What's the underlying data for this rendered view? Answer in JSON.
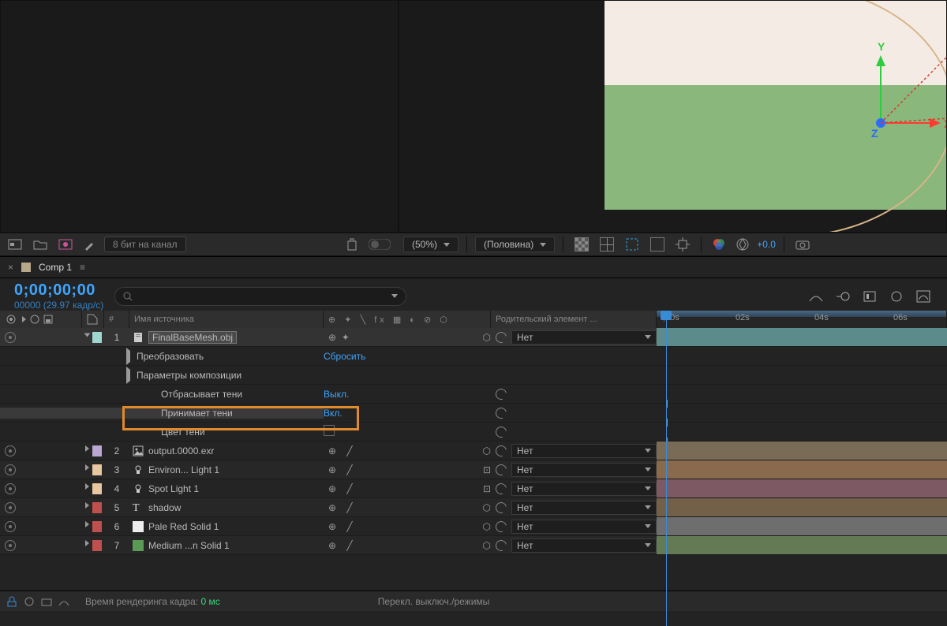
{
  "viewport": {
    "axis": {
      "x": "X",
      "y": "Y",
      "z": "Z"
    }
  },
  "left_strip": {
    "bit_depth": "8 бит на канал"
  },
  "right_strip": {
    "zoom": "(50%)",
    "resolution": "(Половина)",
    "exposure": "+0.0"
  },
  "timeline": {
    "tab": "Comp 1",
    "timecode": "0;00;00;00",
    "framecount": "00000 (29.97 кадр/с)",
    "search_placeholder": "",
    "columns": {
      "name": "Имя источника",
      "parent": "Родительский элемент ..."
    },
    "ruler": {
      "marks": [
        ";00s",
        "02s",
        "04s",
        "06s"
      ]
    },
    "layers": [
      {
        "num": "1",
        "name": "FinalBaseMesh.obj",
        "color": "#9fd7cf",
        "icon": "file",
        "parent": "Нет",
        "track": "#5b8b8b",
        "expanded": true,
        "props": [
          {
            "label": "Преобразовать",
            "value": "Сбросить",
            "twisty": "closed"
          },
          {
            "label": "Параметры композиции",
            "value": "",
            "twisty": "open",
            "children": [
              {
                "label": "Отбрасывает тени",
                "value": "Выкл.",
                "spiral": true
              },
              {
                "label": "Принимает тени",
                "value": "Вкл.",
                "spiral": true,
                "highlighted": true
              },
              {
                "label": "Цвет тени",
                "value": "",
                "spiral": true,
                "swatch": "#222"
              }
            ]
          }
        ]
      },
      {
        "num": "2",
        "name": "output.0000.exr",
        "color": "#b9a7d1",
        "icon": "image",
        "parent": "Нет",
        "track": "#7a6b57"
      },
      {
        "num": "3",
        "name": "Environ... Light 1",
        "color": "#e8c7a0",
        "icon": "light",
        "parent": "Нет",
        "track": "#8a6a4d"
      },
      {
        "num": "4",
        "name": "Spot Light 1",
        "color": "#e8c7a0",
        "icon": "light",
        "parent": "Нет",
        "track": "#7d5a63"
      },
      {
        "num": "5",
        "name": "shadow",
        "color": "#c0504d",
        "icon": "text",
        "parent": "Нет",
        "track": "#736048"
      },
      {
        "num": "6",
        "name": "Pale Red Solid 1",
        "color": "#c0504d",
        "icon": "solid-white",
        "parent": "Нет",
        "track": "#6e6e6e"
      },
      {
        "num": "7",
        "name": "Medium ...n Solid 1",
        "color": "#c0504d",
        "icon": "solid-green",
        "parent": "Нет",
        "track": "#637a55"
      }
    ]
  },
  "footer": {
    "render_label": "Время рендеринга кадра:",
    "render_value": "0 мс",
    "toggle": "Перекл. выключ./режимы"
  }
}
